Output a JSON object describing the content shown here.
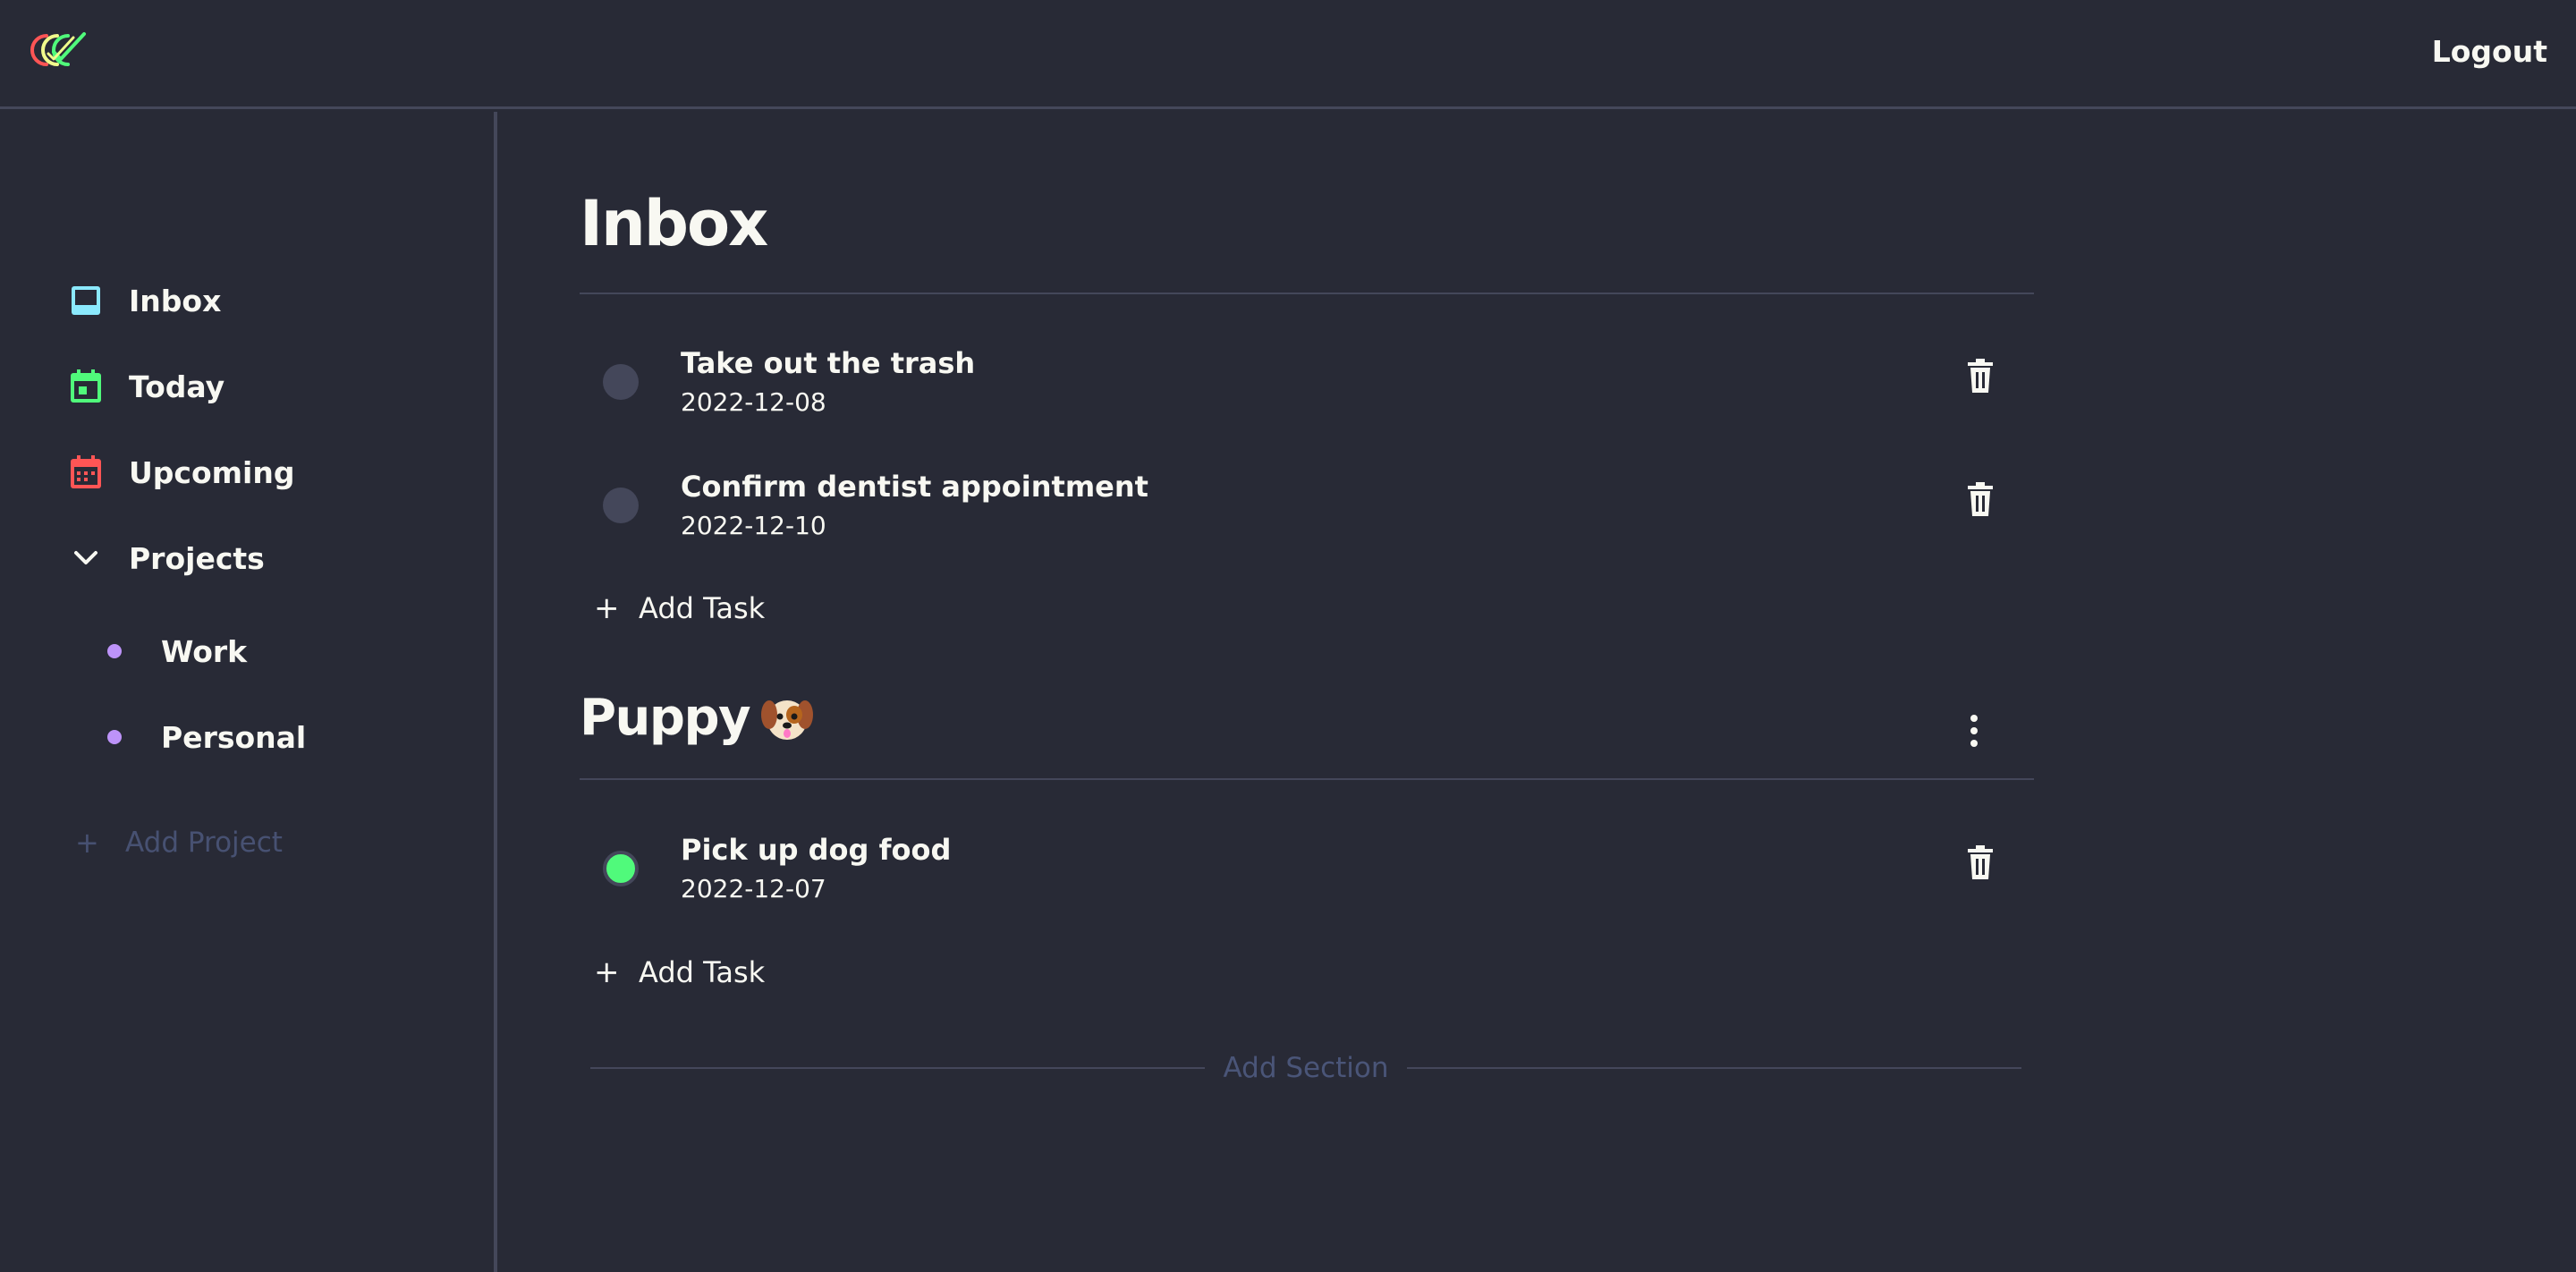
{
  "header": {
    "logo_icon": "app-logo-icon",
    "logout_label": "Logout"
  },
  "sidebar": {
    "items": [
      {
        "label": "Inbox",
        "icon": "inbox-icon",
        "color": "#8be9fd"
      },
      {
        "label": "Today",
        "icon": "calendar-today-icon",
        "color": "#50fa7b"
      },
      {
        "label": "Upcoming",
        "icon": "calendar-upcoming-icon",
        "color": "#ff5555"
      },
      {
        "label": "Projects",
        "icon": "chevron-down-icon",
        "color": "#f8f8f2"
      }
    ],
    "projects": [
      {
        "label": "Work",
        "color": "#bd93f9"
      },
      {
        "label": "Personal",
        "color": "#bd93f9"
      }
    ],
    "add_project_label": "Add Project"
  },
  "main": {
    "title": "Inbox",
    "tasks": [
      {
        "title": "Take out the trash",
        "date": "2022-12-08",
        "completed": false
      },
      {
        "title": "Confirm dentist appointment",
        "date": "2022-12-10",
        "completed": false
      }
    ],
    "add_task_label": "Add Task",
    "sections": [
      {
        "title": "Puppy",
        "emoji": "dog-face-icon",
        "tasks": [
          {
            "title": "Pick up dog food",
            "date": "2022-12-07",
            "completed": true
          }
        ],
        "add_task_label": "Add Task"
      }
    ],
    "add_section_label": "Add Section"
  },
  "colors": {
    "background": "#282a36",
    "border": "#44475a",
    "text": "#f8f8f2",
    "muted": "#6272a4",
    "accent_green": "#50fa7b",
    "accent_red": "#ff5555",
    "accent_cyan": "#8be9fd",
    "accent_purple": "#bd93f9"
  }
}
